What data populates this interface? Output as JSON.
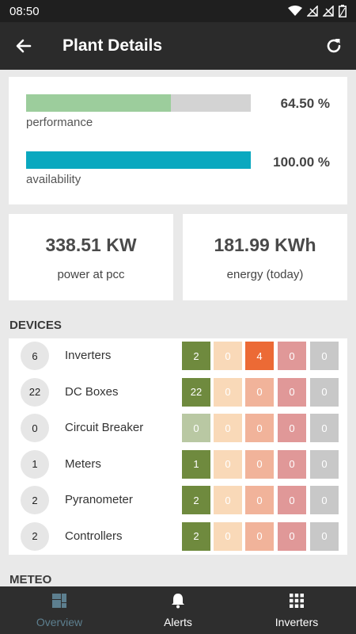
{
  "status_bar": {
    "time": "08:50"
  },
  "app_bar": {
    "title": "Plant Details"
  },
  "performance": {
    "performance": {
      "label": "performance",
      "value_text": "64.50 %",
      "fraction": 0.645,
      "color": "#9ccd9c"
    },
    "availability": {
      "label": "availability",
      "value_text": "100.00 %",
      "fraction": 1.0,
      "color": "#0aa8bf"
    }
  },
  "stats": {
    "power": {
      "value": "338.51 KW",
      "label": "power at pcc"
    },
    "energy": {
      "value": "181.99 KWh",
      "label": "energy (today)"
    }
  },
  "devices": {
    "heading": "DEVICES",
    "rows": [
      {
        "count": "6",
        "name": "Inverters",
        "cells": [
          "2",
          "0",
          "4",
          "0",
          "0"
        ]
      },
      {
        "count": "22",
        "name": "DC Boxes",
        "cells": [
          "22",
          "0",
          "0",
          "0",
          "0"
        ]
      },
      {
        "count": "0",
        "name": "Circuit Breaker",
        "cells": [
          "0",
          "0",
          "0",
          "0",
          "0"
        ]
      },
      {
        "count": "1",
        "name": "Meters",
        "cells": [
          "1",
          "0",
          "0",
          "0",
          "0"
        ]
      },
      {
        "count": "2",
        "name": "Pyranometer",
        "cells": [
          "2",
          "0",
          "0",
          "0",
          "0"
        ]
      },
      {
        "count": "2",
        "name": "Controllers",
        "cells": [
          "2",
          "0",
          "0",
          "0",
          "0"
        ]
      }
    ]
  },
  "meteo": {
    "heading": "METEO"
  },
  "bottom_nav": [
    {
      "label": "Overview",
      "icon": "dashboard-icon",
      "active": false
    },
    {
      "label": "Alerts",
      "icon": "bell-icon",
      "active": true
    },
    {
      "label": "Inverters",
      "icon": "grid-icon",
      "active": true
    }
  ],
  "colors": {
    "status_ok": "#6f8a3e",
    "status_ok_faded": "#b9c8a3",
    "status_warn_light": "#f9d9b8",
    "status_critical": "#ec6a35",
    "status_critical_faded": "#f1b39a",
    "status_error": "#e09898",
    "status_offline": "#c8c8c8"
  }
}
